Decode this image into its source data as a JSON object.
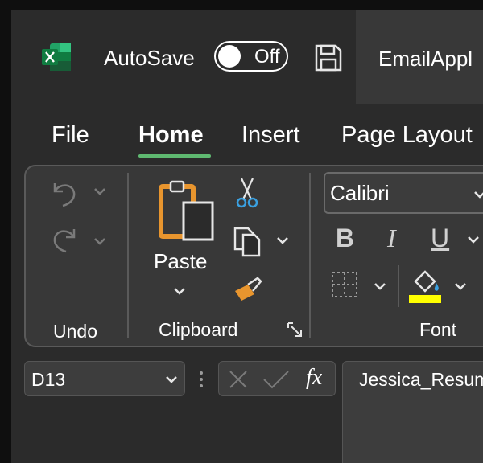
{
  "titlebar": {
    "autosave_label": "AutoSave",
    "autosave_state": "Off",
    "document_title": "EmailAppl",
    "app_icon": "excel-logo-icon",
    "save_icon": "save-icon"
  },
  "tabs": [
    {
      "label": "File"
    },
    {
      "label": "Home",
      "active": true
    },
    {
      "label": "Insert"
    },
    {
      "label": "Page Layout"
    }
  ],
  "ribbon": {
    "groups": {
      "undo": {
        "label": "Undo"
      },
      "clipboard": {
        "label": "Clipboard",
        "paste_label": "Paste"
      },
      "font": {
        "label": "Font",
        "font_name": "Calibri",
        "bold": "B",
        "italic": "I",
        "underline": "U",
        "fill_color": "#ffff00"
      }
    }
  },
  "formula_bar": {
    "name_box": "D13",
    "fx_label": "fx",
    "content": "Jessica_Resum"
  },
  "colors": {
    "accent": "#5fb971",
    "background": "#2b2b2b",
    "ribbon": "#383838"
  }
}
